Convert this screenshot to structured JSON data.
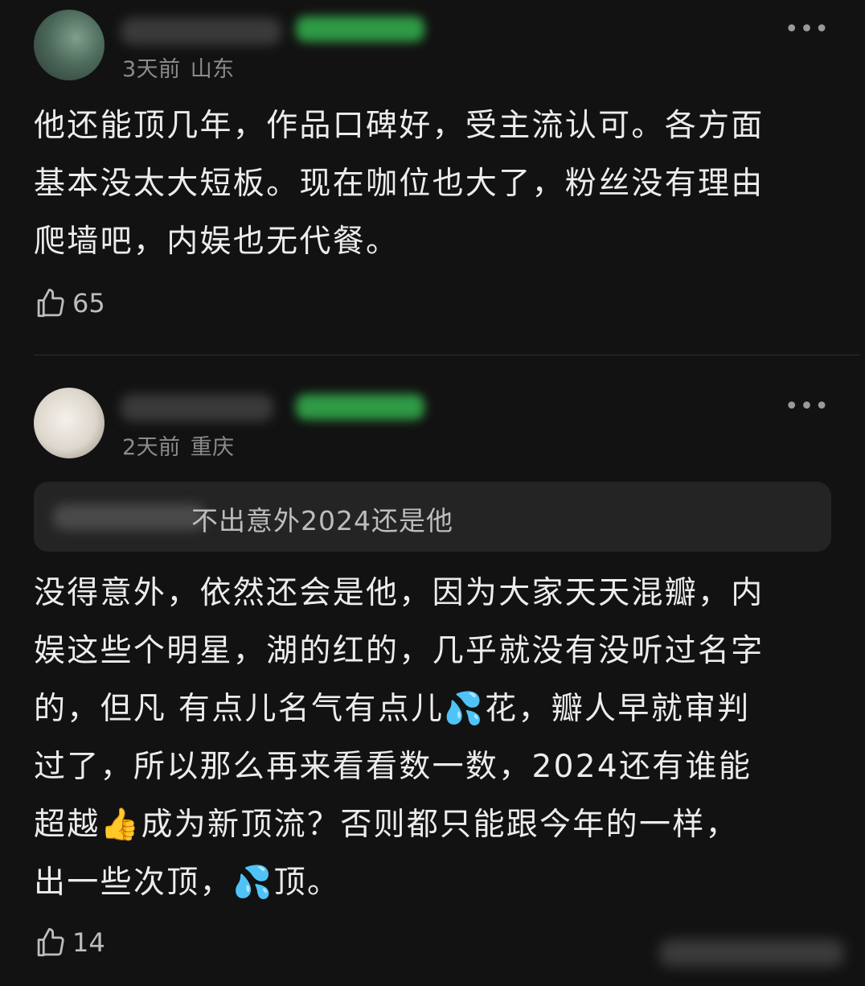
{
  "comments": [
    {
      "time": "3天前",
      "location": "山东",
      "more_label": "•••",
      "text": "他还能顶几年，作品口碑好，受主流认可。各方面\n基本没太大短板。现在咖位也大了，粉丝没有理由\n爬墙吧，内娱也无代餐。",
      "likes": "65",
      "like_icon": "thumbs-up-outline"
    },
    {
      "time": "2天前",
      "location": "重庆",
      "more_label": "•••",
      "quote_text": "不出意外2024还是他",
      "text": "没得意外，依然还会是他，因为大家天天混瓣，内\n娱这些个明星，湖的红的，几乎就没有没听过名字\n的，但凡 有点儿名气有点儿💦花，瓣人早就审判\n过了，所以那么再来看看数一数，2024还有谁能\n超越👍成为新顶流？否则都只能跟今年的一样，\n出一些次顶，💦顶。",
      "likes": "14",
      "like_icon": "thumbs-up-outline"
    }
  ],
  "colors": {
    "background": "#121212",
    "text": "#ececec",
    "meta": "#8b8b8b",
    "badge_green": "#2f9a45",
    "quote_bg": "#242424"
  }
}
